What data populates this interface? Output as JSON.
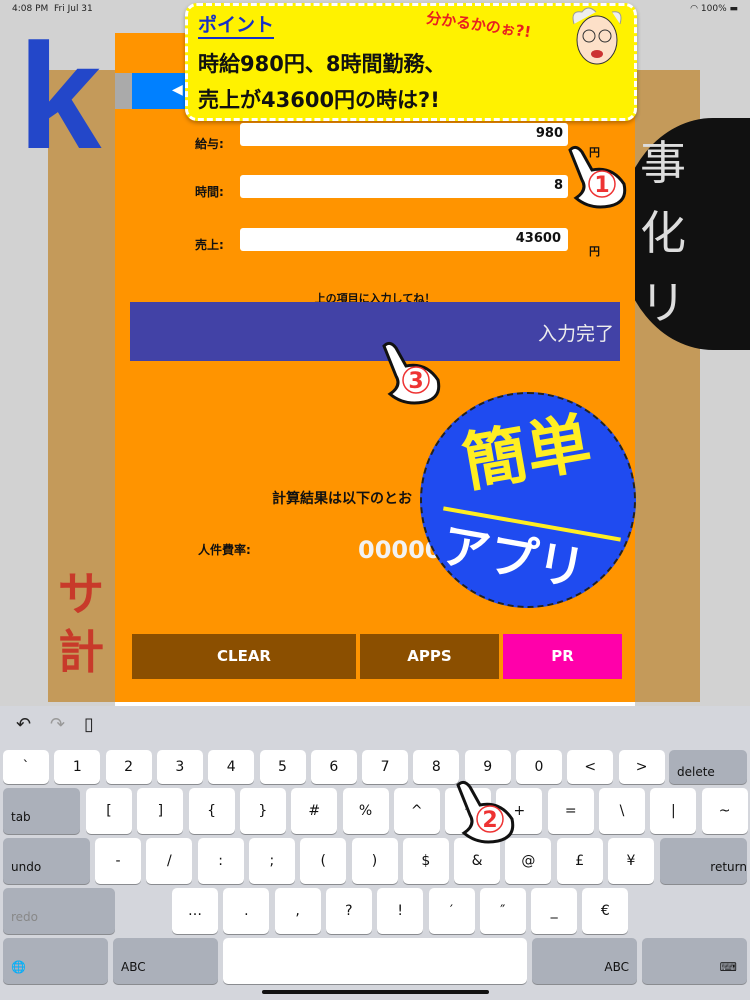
{
  "status": {
    "time": "4:08 PM",
    "date": "Fri Jul 31",
    "battery": "100%"
  },
  "background": {
    "logo_letter": "k",
    "circle_text": [
      "事",
      "化",
      "リ"
    ],
    "red_text": [
      "サ",
      "計"
    ]
  },
  "banner": {
    "heading": "ポイント",
    "line1": "時給980円、8時間勤務、",
    "line2": "売上が43600円の時は?!",
    "speech": "分かるかのぉ?!"
  },
  "back_button": {
    "label": "◀"
  },
  "form": {
    "fields": [
      {
        "label": "給与:",
        "value": "980",
        "unit": "円"
      },
      {
        "label": "時間:",
        "value": "8",
        "unit": ""
      },
      {
        "label": "売上:",
        "value": "43600",
        "unit": "円"
      }
    ],
    "hint": "上の項目に入力してね！",
    "submit_label": "入力完了"
  },
  "result": {
    "heading": "計算結果は以下のとお",
    "rate_label": "人件費率:",
    "rate_value": "00000"
  },
  "sticker": {
    "line1": "簡単",
    "line2": "アプリ"
  },
  "buttons": {
    "clear": "CLEAR",
    "apps": "APPS",
    "pr": "PR"
  },
  "annotations": {
    "step1": "1",
    "step2": "2",
    "step3": "3"
  },
  "colors": {
    "modal": "#ff9400",
    "submit": "#4242a6",
    "clear": "#8b4f00",
    "pr": "#ff00aa",
    "banner": "#fff200"
  },
  "keyboard": {
    "row1": [
      "`",
      "1",
      "2",
      "3",
      "4",
      "5",
      "6",
      "7",
      "8",
      "9",
      "0",
      "<",
      ">"
    ],
    "delete": "delete",
    "tab": "tab",
    "row2": [
      "[",
      "]",
      "{",
      "}",
      "#",
      "%",
      "^",
      "*",
      "+",
      "=",
      "\\",
      "|",
      "~"
    ],
    "undo": "undo",
    "row3": [
      "-",
      "/",
      ":",
      ";",
      "(",
      ")",
      "$",
      "&",
      "@",
      "£",
      "¥"
    ],
    "return": "return",
    "redo": "redo",
    "row4": [
      "…",
      ".",
      ",",
      "?",
      "!",
      "′",
      "″",
      "_",
      "€"
    ],
    "abc": "ABC",
    "toolbar_icons": [
      "undo-arrow-icon",
      "redo-arrow-icon",
      "paste-icon"
    ]
  }
}
